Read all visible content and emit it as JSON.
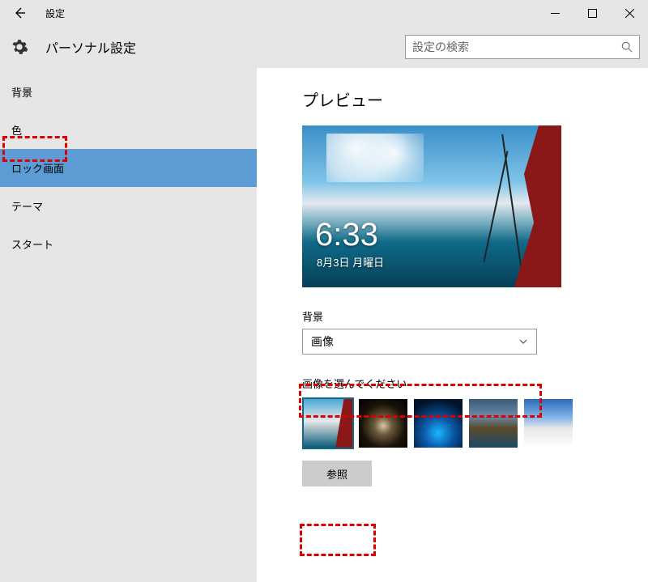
{
  "window": {
    "title": "設定"
  },
  "header": {
    "title": "パーソナル設定",
    "search_placeholder": "設定の検索"
  },
  "sidebar": {
    "items": [
      {
        "label": "背景"
      },
      {
        "label": "色"
      },
      {
        "label": "ロック画面"
      },
      {
        "label": "テーマ"
      },
      {
        "label": "スタート"
      }
    ],
    "selected_index": 2
  },
  "content": {
    "preview_heading": "プレビュー",
    "preview_time": "6:33",
    "preview_date": "8月3日 月曜日",
    "background_label": "背景",
    "background_value": "画像",
    "choose_image_label": "画像を選んでください",
    "browse_label": "参照"
  }
}
